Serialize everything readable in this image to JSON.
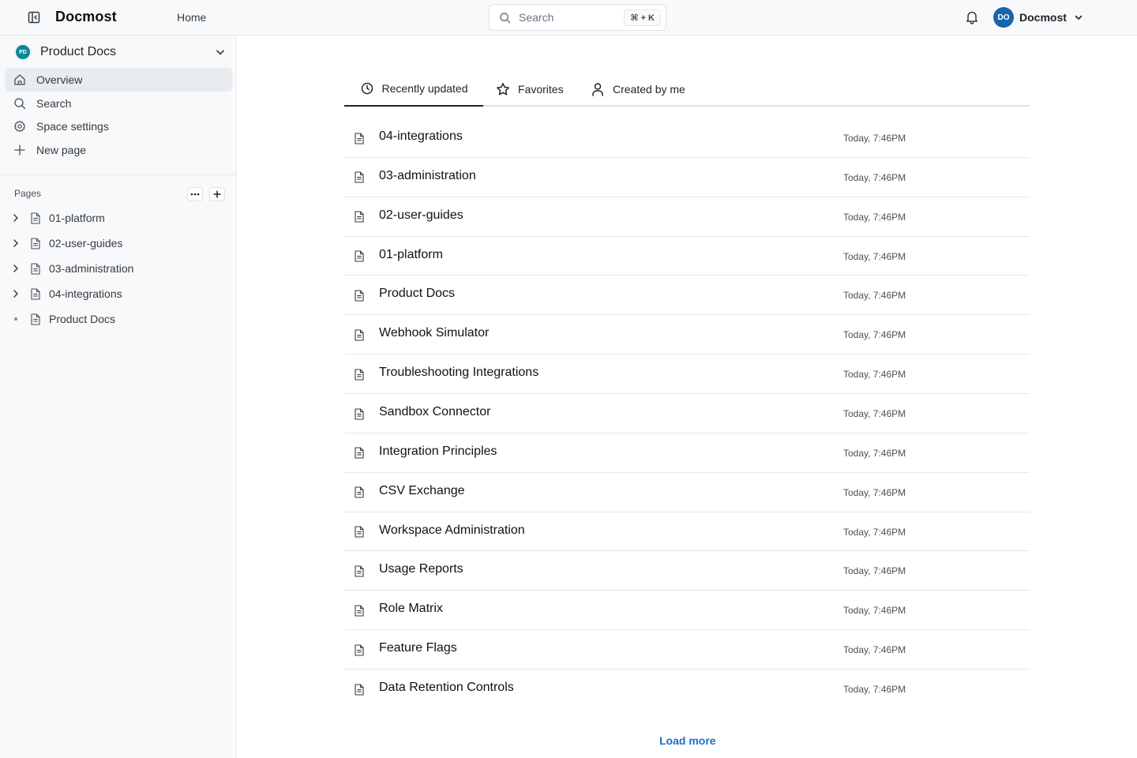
{
  "header": {
    "app_title": "Docmost",
    "home_label": "Home",
    "search_placeholder": "Search",
    "search_shortcut": "⌘ + K",
    "user_initials": "DO",
    "user_name": "Docmost"
  },
  "sidebar": {
    "space_initials": "PD",
    "space_name": "Product Docs",
    "nav": [
      {
        "label": "Overview",
        "icon": "home-icon",
        "active": true
      },
      {
        "label": "Search",
        "icon": "search-icon"
      },
      {
        "label": "Space settings",
        "icon": "gear-icon"
      },
      {
        "label": "New page",
        "icon": "plus-icon"
      }
    ],
    "pages_label": "Pages",
    "tree": [
      {
        "label": "01-platform",
        "expandable": true
      },
      {
        "label": "02-user-guides",
        "expandable": true
      },
      {
        "label": "03-administration",
        "expandable": true
      },
      {
        "label": "04-integrations",
        "expandable": true
      },
      {
        "label": "Product Docs",
        "expandable": false
      }
    ]
  },
  "main": {
    "tabs": [
      {
        "label": "Recently updated",
        "icon": "clock-icon",
        "active": true
      },
      {
        "label": "Favorites",
        "icon": "star-icon"
      },
      {
        "label": "Created by me",
        "icon": "user-icon"
      }
    ],
    "pages": [
      {
        "title": "04-integrations",
        "updated": "Today, 7:46PM"
      },
      {
        "title": "03-administration",
        "updated": "Today, 7:46PM"
      },
      {
        "title": "02-user-guides",
        "updated": "Today, 7:46PM"
      },
      {
        "title": "01-platform",
        "updated": "Today, 7:46PM"
      },
      {
        "title": "Product Docs",
        "updated": "Today, 7:46PM"
      },
      {
        "title": "Webhook Simulator",
        "updated": "Today, 7:46PM"
      },
      {
        "title": "Troubleshooting Integrations",
        "updated": "Today, 7:46PM"
      },
      {
        "title": "Sandbox Connector",
        "updated": "Today, 7:46PM"
      },
      {
        "title": "Integration Principles",
        "updated": "Today, 7:46PM"
      },
      {
        "title": "CSV Exchange",
        "updated": "Today, 7:46PM"
      },
      {
        "title": "Workspace Administration",
        "updated": "Today, 7:46PM"
      },
      {
        "title": "Usage Reports",
        "updated": "Today, 7:46PM"
      },
      {
        "title": "Role Matrix",
        "updated": "Today, 7:46PM"
      },
      {
        "title": "Feature Flags",
        "updated": "Today, 7:46PM"
      },
      {
        "title": "Data Retention Controls",
        "updated": "Today, 7:46PM"
      }
    ],
    "load_more_label": "Load more"
  },
  "colors": {
    "accent": "#1971c2",
    "user_avatar": "#1864ab",
    "space_avatar": "#0c8599"
  }
}
